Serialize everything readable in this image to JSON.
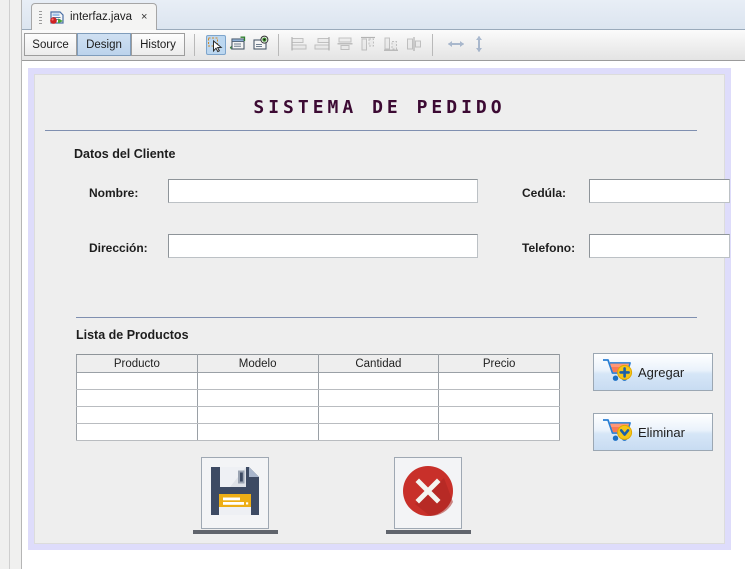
{
  "window": {
    "tab": {
      "title": "interfaz.java",
      "close_label": "×",
      "icon": "java-file-icon"
    }
  },
  "modebar": {
    "buttons": [
      {
        "label": "Source",
        "active": false
      },
      {
        "label": "Design",
        "active": true
      },
      {
        "label": "History",
        "active": false
      }
    ],
    "tools": [
      {
        "name": "selection-mode-icon",
        "active": true
      },
      {
        "name": "connection-mode-icon",
        "active": false
      },
      {
        "name": "preview-design-icon",
        "active": false
      },
      {
        "name": "align-left-icon",
        "active": false
      },
      {
        "name": "align-right-icon",
        "active": false
      },
      {
        "name": "align-center-horizontal-icon",
        "active": false
      },
      {
        "name": "align-top-icon",
        "active": false
      },
      {
        "name": "align-bottom-icon",
        "active": false
      },
      {
        "name": "align-center-vertical-icon",
        "active": false
      },
      {
        "name": "resize-width-icon",
        "active": false
      },
      {
        "name": "resize-height-icon",
        "active": false
      }
    ]
  },
  "form": {
    "title": "SISTEMA DE PEDIDO",
    "title_color": "#3c0a33",
    "accent_color": "#7f8fb0",
    "panel_bg": "#eeeeee",
    "selection_color": "#dedcfb",
    "client_section": {
      "heading": "Datos del Cliente",
      "fields": [
        {
          "label": "Nombre:",
          "value": "",
          "placeholder": ""
        },
        {
          "label": "Cedúla:",
          "value": "",
          "placeholder": ""
        },
        {
          "label": "Dirección:",
          "value": "",
          "placeholder": ""
        },
        {
          "label": "Telefono:",
          "value": "",
          "placeholder": ""
        }
      ]
    },
    "products_section": {
      "heading": "Lista de Productos",
      "columns": [
        "Producto",
        "Modelo",
        "Cantidad",
        "Precio"
      ],
      "rows": [
        [
          "",
          "",
          "",
          ""
        ],
        [
          "",
          "",
          "",
          ""
        ],
        [
          "",
          "",
          "",
          ""
        ],
        [
          "",
          "",
          "",
          ""
        ]
      ],
      "buttons": [
        {
          "label": "Agregar",
          "icon": "cart-add-icon"
        },
        {
          "label": "Eliminar",
          "icon": "cart-remove-icon"
        }
      ]
    },
    "action_buttons": [
      {
        "name": "save-button",
        "icon": "floppy-disk-save-icon"
      },
      {
        "name": "cancel-button",
        "icon": "red-circle-x-cancel-icon"
      }
    ]
  }
}
